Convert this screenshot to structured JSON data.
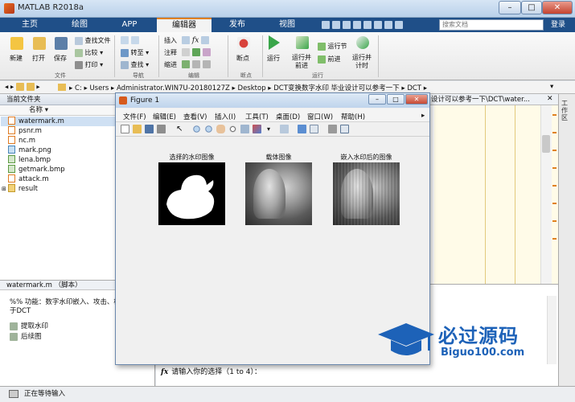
{
  "app": {
    "title": "MATLAB R2018a"
  },
  "window_controls": {
    "minimize": "–",
    "maximize": "□",
    "close": "✕"
  },
  "ribbon_tabs": [
    "主页",
    "绘图",
    "APP",
    "编辑器",
    "发布",
    "视图"
  ],
  "active_tab": "编辑器",
  "search": {
    "placeholder": "搜索文档",
    "login": "登录"
  },
  "toolstrip": {
    "file": {
      "new": "新建",
      "open": "打开",
      "save": "保存",
      "find_files": "查找文件",
      "compare": "比较",
      "print": "打印",
      "group": "文件"
    },
    "navigate": {
      "goto": "转至",
      "find": "查找",
      "group": "导航"
    },
    "edit": {
      "insert": "插入",
      "comment": "注释",
      "indent": "缩进",
      "fx": "fx",
      "group": "编辑"
    },
    "breakpoints": {
      "label": "断点",
      "group": "断点"
    },
    "run": {
      "run": "运行",
      "run_advance": "运行并\n前进",
      "run_section": "运行节",
      "advance": "前进",
      "run_time": "运行并\n计时",
      "group": "运行"
    }
  },
  "address": {
    "segments": [
      "C:",
      "Users",
      "Administrator.WIN7U-20180127Z",
      "Desktop",
      "DCT变换数字水印  毕业设计可以参考一下",
      "DCT"
    ]
  },
  "current_folder": {
    "title": "当前文件夹",
    "name_column": "名称",
    "files": [
      {
        "name": "watermark.m",
        "type": "m"
      },
      {
        "name": "psnr.m",
        "type": "m"
      },
      {
        "name": "nc.m",
        "type": "m"
      },
      {
        "name": "mark.png",
        "type": "png"
      },
      {
        "name": "lena.bmp",
        "type": "bmp"
      },
      {
        "name": "getmark.bmp",
        "type": "bmp"
      },
      {
        "name": "attack.m",
        "type": "m"
      },
      {
        "name": "result",
        "type": "dir"
      }
    ]
  },
  "details": {
    "header": "watermark.m  （脚本）",
    "comment_line1": "%% 功能：数字水印嵌入、攻击、检",
    "comment_line2": "于DCT",
    "items": [
      "提取水印",
      "后续图"
    ]
  },
  "editor": {
    "tab_path": "设计可以参考一下\\DCT\\water..."
  },
  "workspace": {
    "label": "工作区"
  },
  "command": {
    "fx": "fx",
    "prompt": "请输入你的选择（1 to 4）："
  },
  "status": {
    "text": "正在等待输入"
  },
  "figure": {
    "title": "Figure 1",
    "menus": [
      "文件(F)",
      "编辑(E)",
      "查看(V)",
      "插入(I)",
      "工具(T)",
      "桌面(D)",
      "窗口(W)",
      "帮助(H)"
    ],
    "panels": [
      {
        "title": "选择的水印图像"
      },
      {
        "title": "载体图像"
      },
      {
        "title": "嵌入水印后的图像"
      }
    ]
  },
  "watermark_logo": {
    "cn": "必过源码",
    "en": "Biguo100.com"
  },
  "colors": {
    "accent": "#1f4f88",
    "active_tab_border": "#e0801f",
    "logo_blue": "#1d62b8"
  }
}
